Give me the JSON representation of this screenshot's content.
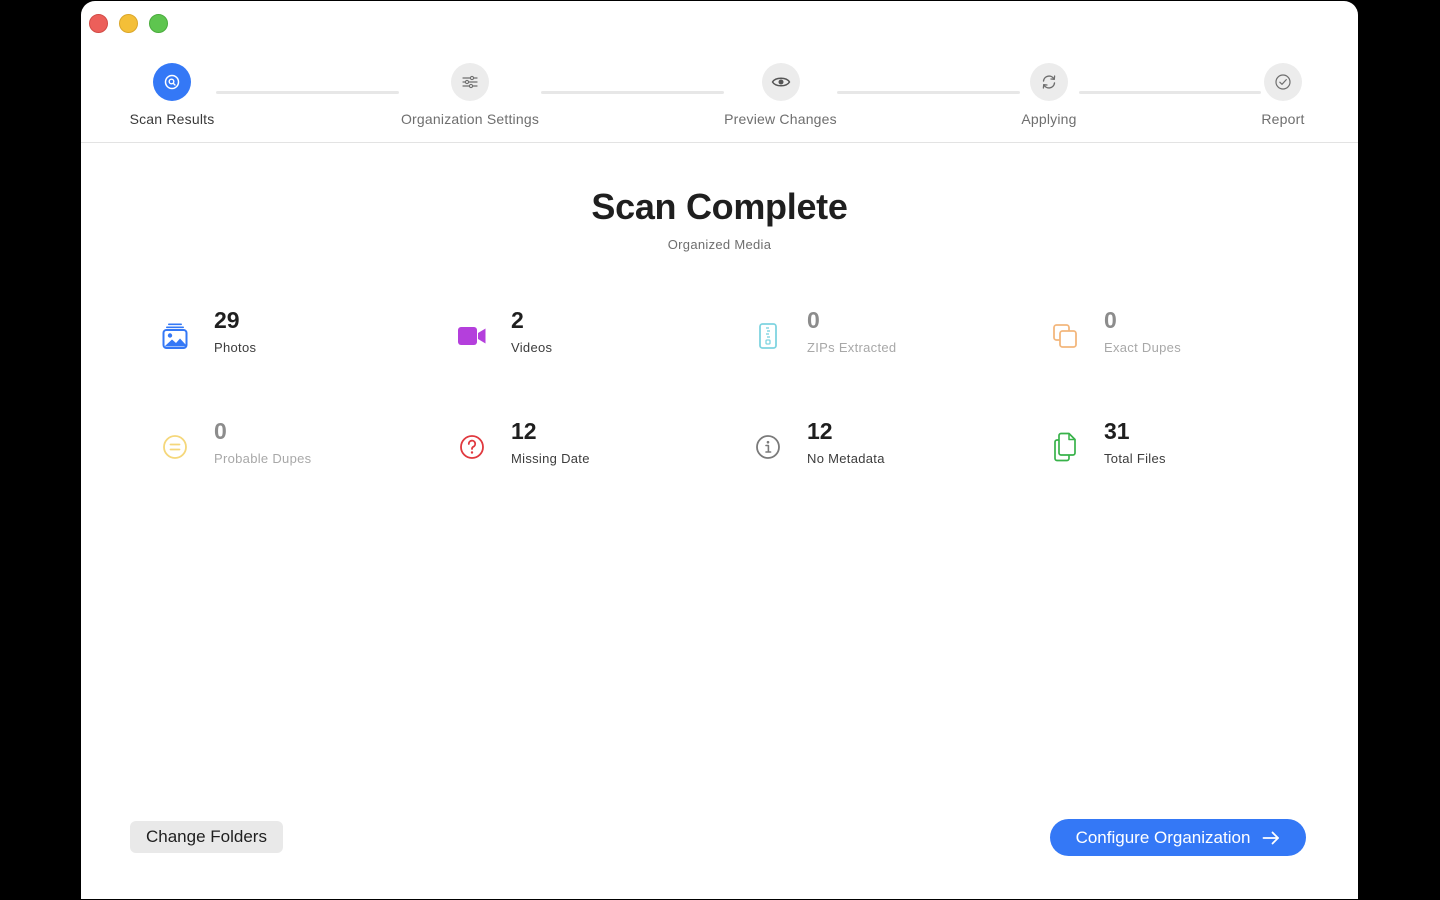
{
  "window": {
    "colors": {
      "accent": "#3478f6",
      "background": "#ffffff"
    }
  },
  "steps": [
    {
      "label": "Scan Results",
      "icon": "magnifier-icon",
      "state": "active"
    },
    {
      "label": "Organization Settings",
      "icon": "sliders-icon",
      "state": "pending"
    },
    {
      "label": "Preview Changes",
      "icon": "eye-icon",
      "state": "pending"
    },
    {
      "label": "Applying",
      "icon": "sync-icon",
      "state": "pending"
    },
    {
      "label": "Report",
      "icon": "checkmark-circle-icon",
      "state": "pending"
    }
  ],
  "header": {
    "title": "Scan Complete",
    "subtitle": "Organized Media"
  },
  "stats": [
    {
      "value": "29",
      "label": "Photos",
      "icon": "photos-icon",
      "color": "#3478f6"
    },
    {
      "value": "2",
      "label": "Videos",
      "icon": "video-camera-icon",
      "color": "#b43fdc"
    },
    {
      "value": "0",
      "label": "ZIPs Extracted",
      "icon": "zip-icon",
      "color": "#7fd4e0"
    },
    {
      "value": "0",
      "label": "Exact Dupes",
      "icon": "duplicate-icon",
      "color": "#f3b77d"
    },
    {
      "value": "0",
      "label": "Probable Dupes",
      "icon": "equal-circle-icon",
      "color": "#f5d77a"
    },
    {
      "value": "12",
      "label": "Missing Date",
      "icon": "question-circle-icon",
      "color": "#e0383e"
    },
    {
      "value": "12",
      "label": "No Metadata",
      "icon": "info-circle-icon",
      "color": "#7a7a7a"
    },
    {
      "value": "31",
      "label": "Total Files",
      "icon": "documents-icon",
      "color": "#38b24a"
    }
  ],
  "footer": {
    "change_folders_label": "Change Folders",
    "configure_label": "Configure Organization"
  }
}
